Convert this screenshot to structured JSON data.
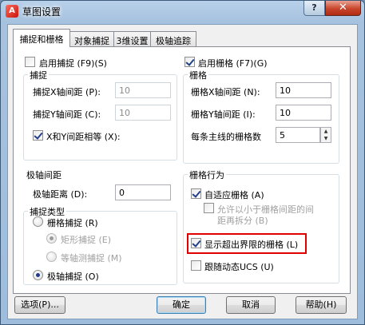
{
  "window": {
    "title": "草图设置",
    "app_icon_glyph": "A",
    "help_glyph": "?",
    "close_glyph": "✕"
  },
  "tabs": [
    {
      "label": "捕捉和栅格",
      "active": true
    },
    {
      "label": "对象捕捉",
      "active": false
    },
    {
      "label": "3维设置",
      "active": false
    },
    {
      "label": "极轴追踪",
      "active": false
    }
  ],
  "snap": {
    "enable_label": "启用捕捉 (F9)(S)",
    "enable_checked": false,
    "group_title": "捕捉",
    "x_label": "捕捉X轴间距 (P):",
    "x_value": "10",
    "y_label": "捕捉Y轴间距 (C):",
    "y_value": "10",
    "equal_label": "X和Y间距相等 (X):",
    "equal_checked": true
  },
  "polar": {
    "group_title": "极轴间距",
    "distance_label": "极轴距离 (D):",
    "distance_value": "0"
  },
  "snap_type": {
    "group_title": "捕捉类型",
    "grid_snap_label": "栅格捕捉 (R)",
    "rect_snap_label": "矩形捕捉 (E)",
    "iso_snap_label": "等轴测捕捉 (M)",
    "polar_snap_label": "极轴捕捉 (O)",
    "selected": "polar"
  },
  "grid": {
    "enable_label": "启用栅格 (F7)(G)",
    "enable_checked": true,
    "group_title": "栅格",
    "x_label": "栅格X轴间距 (N):",
    "x_value": "10",
    "y_label": "栅格Y轴间距 (I):",
    "y_value": "10",
    "major_label": "每条主线的栅格数",
    "major_value": "5"
  },
  "grid_behavior": {
    "group_title": "栅格行为",
    "adaptive_label": "自适应栅格 (A)",
    "adaptive_checked": true,
    "subdivide_label_line1": "允许以小于栅格间距的间",
    "subdivide_label_line2": "距再拆分 (B)",
    "subdivide_checked": false,
    "beyond_label": "显示超出界限的栅格 (L)",
    "beyond_checked": true,
    "follow_label": "跟随动态UCS (U)",
    "follow_checked": false
  },
  "buttons": {
    "options": "选项(P)...",
    "ok": "确定",
    "cancel": "取消",
    "help": "帮助(H)"
  },
  "colors": {
    "highlight": "#e00000",
    "title_bar": "#a6c2df",
    "close_button": "#c8452b"
  }
}
